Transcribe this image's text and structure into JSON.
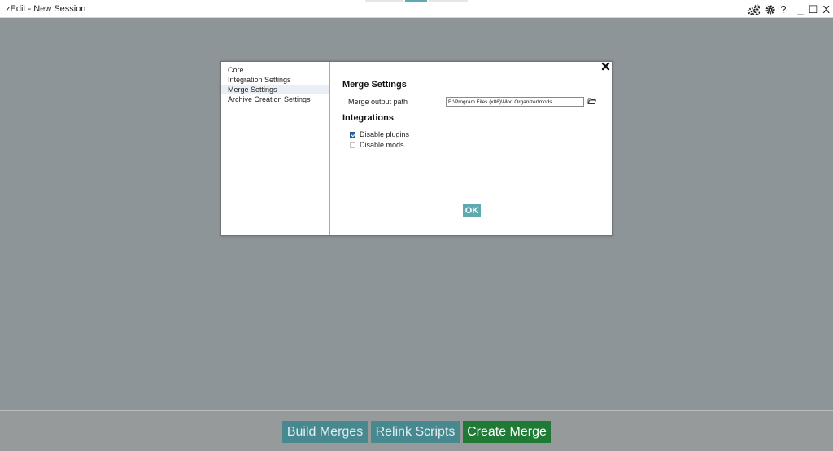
{
  "window": {
    "title": "zEdit - New Session",
    "controls": {
      "minimize": "_",
      "maximize": "☐",
      "close": "X",
      "help": "?"
    },
    "icons": [
      "cogs-icon",
      "gear-icon"
    ],
    "top_tabs": [
      {
        "color": "#e6e6e6"
      },
      {
        "color": "#5fa9b0"
      },
      {
        "color": "#e6e6e6"
      }
    ]
  },
  "settings_modal": {
    "nav": [
      {
        "label": "Core",
        "active": false
      },
      {
        "label": "Integration Settings",
        "active": false
      },
      {
        "label": "Merge Settings",
        "active": true
      },
      {
        "label": "Archive Creation Settings",
        "active": false
      }
    ],
    "merge_section": {
      "title": "Merge Settings",
      "output_path_label": "Merge output path",
      "output_path_value": "E:\\Program Files (x86)\\Mod Organizer\\mods"
    },
    "integrations_section": {
      "title": "Integrations",
      "options": [
        {
          "label": "Disable plugins",
          "checked": true
        },
        {
          "label": "Disable mods",
          "checked": false
        }
      ]
    },
    "ok_label": "OK"
  },
  "footer": {
    "buttons": [
      {
        "label": "Build Merges"
      },
      {
        "label": "Relink Scripts"
      },
      {
        "label": "Create Merge"
      }
    ]
  },
  "colors": {
    "workspace": "#8e9598",
    "teal_button": "#48888f",
    "green_button": "#1f7a35",
    "ok_button": "#5fa9b0"
  }
}
